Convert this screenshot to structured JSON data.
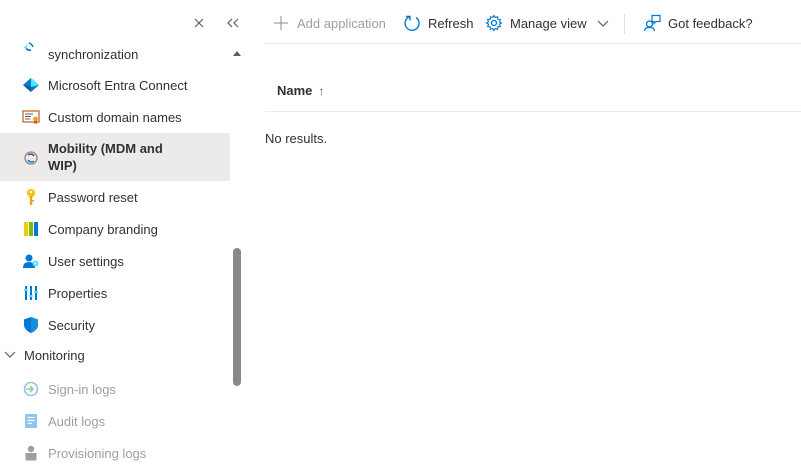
{
  "sidebar": {
    "items": [
      {
        "label": "synchronization",
        "icon": "sync-icon"
      },
      {
        "label": "Microsoft Entra Connect",
        "icon": "entra-connect-icon"
      },
      {
        "label": "Custom domain names",
        "icon": "domain-certificate-icon"
      },
      {
        "label": "Mobility (MDM and WIP)",
        "label_line1": "Mobility (MDM and",
        "label_line2": "WIP)",
        "icon": "mobility-icon",
        "selected": true
      },
      {
        "label": "Password reset",
        "icon": "key-icon"
      },
      {
        "label": "Company branding",
        "icon": "branding-icon"
      },
      {
        "label": "User settings",
        "icon": "user-settings-icon"
      },
      {
        "label": "Properties",
        "icon": "properties-icon"
      },
      {
        "label": "Security",
        "icon": "shield-icon"
      }
    ],
    "group": {
      "label": "Monitoring",
      "expanded": true
    },
    "subitems": [
      {
        "label": "Sign-in logs",
        "icon": "sign-in-icon"
      },
      {
        "label": "Audit logs",
        "icon": "audit-log-icon"
      },
      {
        "label": "Provisioning logs",
        "icon": "provisioning-icon"
      }
    ]
  },
  "toolbar": {
    "add": "Add application",
    "refresh": "Refresh",
    "manage_view": "Manage view",
    "feedback": "Got feedback?"
  },
  "grid": {
    "column_name": "Name",
    "sort_indicator": "↑",
    "empty": "No results."
  },
  "colors": {
    "accent": "#0078d4",
    "selected_bg": "#edebe9",
    "disabled_text": "#a19f9d"
  }
}
